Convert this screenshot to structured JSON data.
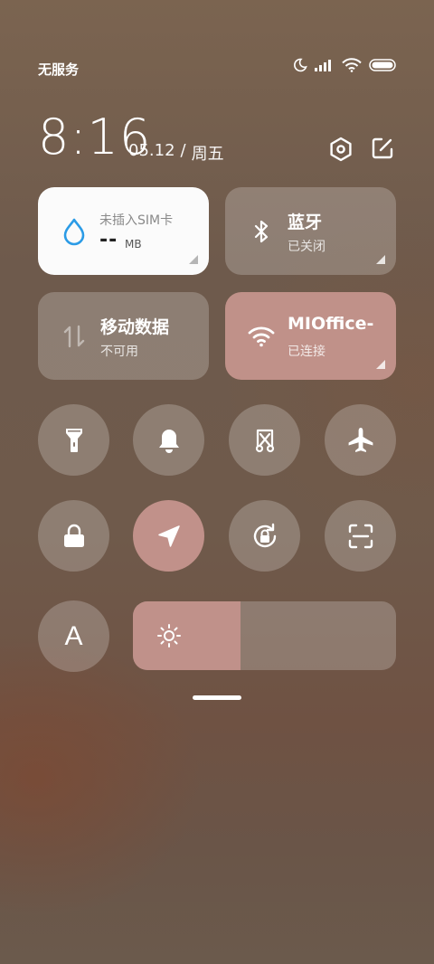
{
  "status_bar": {
    "carrier": "无服务",
    "icons": [
      "moon-icon",
      "signal-icon",
      "wifi-icon",
      "battery-icon"
    ]
  },
  "header": {
    "time": "8:16",
    "date": "05.12",
    "separator": "/",
    "weekday": "周五",
    "icons": [
      "settings-hexagon-icon",
      "edit-icon"
    ]
  },
  "tiles": {
    "data_usage": {
      "title": "未插入SIM卡",
      "value": "--",
      "unit": "MB",
      "icon": "water-drop-icon"
    },
    "bluetooth": {
      "title": "蓝牙",
      "subtitle": "已关闭",
      "icon": "bluetooth-icon"
    },
    "mobile_data": {
      "title": "移动数据",
      "subtitle": "不可用",
      "icon": "data-arrows-icon"
    },
    "wifi": {
      "title": "MIOffice-",
      "subtitle": "已连接",
      "icon": "wifi-icon"
    }
  },
  "toggles": [
    {
      "name": "flashlight",
      "icon": "flashlight-icon",
      "active": false
    },
    {
      "name": "ring",
      "icon": "bell-icon",
      "active": false
    },
    {
      "name": "screenshot",
      "icon": "scissors-screenshot-icon",
      "active": false
    },
    {
      "name": "airplane",
      "icon": "airplane-icon",
      "active": false
    },
    {
      "name": "lock",
      "icon": "lock-icon",
      "active": false
    },
    {
      "name": "location",
      "icon": "location-arrow-icon",
      "active": true
    },
    {
      "name": "rotation-lock",
      "icon": "rotation-lock-icon",
      "active": false
    },
    {
      "name": "scanner",
      "icon": "scan-icon",
      "active": false
    }
  ],
  "auto_brightness": {
    "label": "A",
    "icon": "auto-brightness-icon"
  },
  "brightness": {
    "level": 0.41,
    "icon": "sun-icon"
  },
  "colors": {
    "active_pink": "#c09189",
    "tile_bg": "rgba(255,255,255,0.22)",
    "white_tile": "#fbfbfb",
    "drop_blue": "#2b9be6"
  }
}
